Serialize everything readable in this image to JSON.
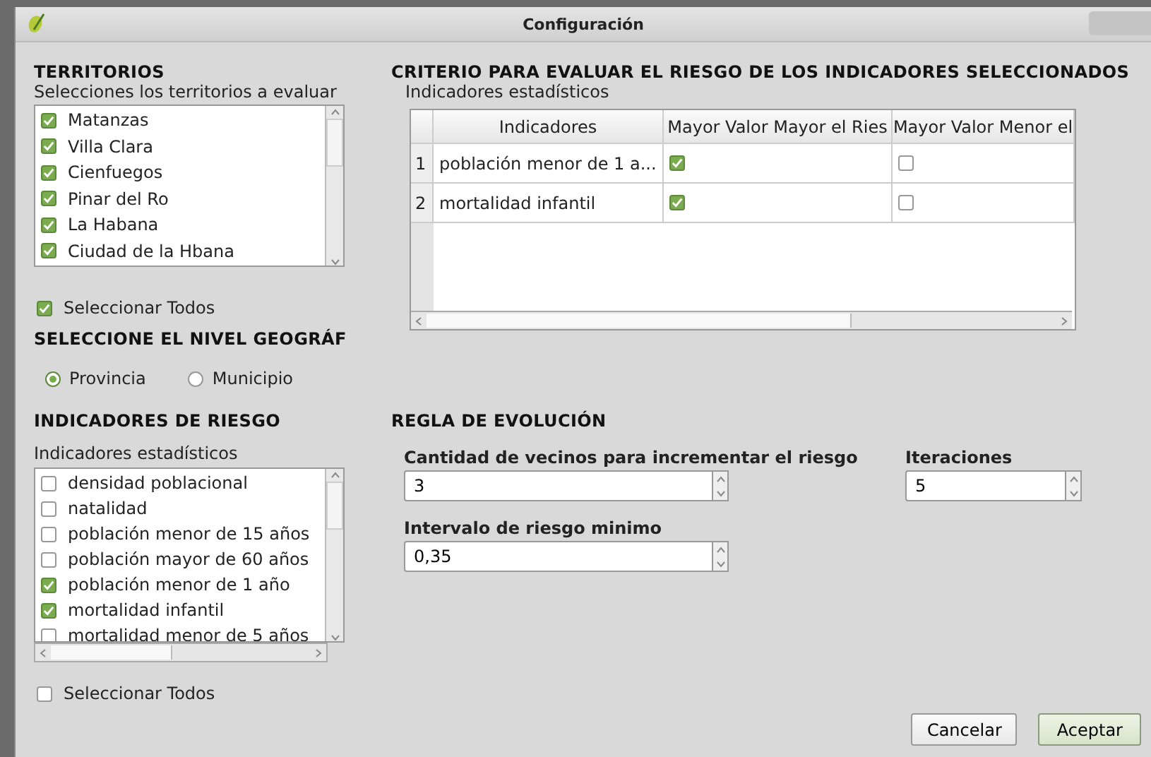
{
  "window": {
    "title": "Configuración"
  },
  "territorios": {
    "heading": "TERRITORIOS",
    "subtitle": "Selecciones los territorios a evaluar",
    "items": [
      {
        "label": "Matanzas",
        "checked": true
      },
      {
        "label": "Villa Clara",
        "checked": true
      },
      {
        "label": "Cienfuegos",
        "checked": true
      },
      {
        "label": "Pinar del Ro",
        "checked": true
      },
      {
        "label": "La Habana",
        "checked": true
      },
      {
        "label": "Ciudad de la Hbana",
        "checked": true
      }
    ],
    "select_all": {
      "label": "Seleccionar Todos",
      "checked": true
    }
  },
  "nivel": {
    "heading": "SELECCIONE EL NIVEL GEOGRÁF",
    "options": [
      {
        "label": "Provincia",
        "selected": true
      },
      {
        "label": "Municipio",
        "selected": false
      }
    ]
  },
  "indicadores": {
    "heading": "INDICADORES DE RIESGO",
    "subtitle": "Indicadores estadísticos",
    "items": [
      {
        "label": "densidad poblacional",
        "checked": false
      },
      {
        "label": "natalidad",
        "checked": false
      },
      {
        "label": "población menor de 15 años",
        "checked": false
      },
      {
        "label": "población mayor de 60 años",
        "checked": false
      },
      {
        "label": "población menor de 1 año",
        "checked": true
      },
      {
        "label": "mortalidad infantil",
        "checked": true
      },
      {
        "label": "mortalidad menor de 5 años",
        "checked": false
      }
    ],
    "select_all": {
      "label": "Seleccionar Todos",
      "checked": false
    }
  },
  "criterio": {
    "heading": "CRITERIO PARA EVALUAR EL RIESGO DE LOS INDICADORES SELECCIONADOS",
    "subtitle": "Indicadores estadísticos",
    "table": {
      "columns": [
        "Indicadores",
        "Mayor Valor Mayor el Ries",
        "Mayor Valor Menor el"
      ],
      "rows": [
        {
          "number": "1",
          "indicator": "población menor de 1 a...",
          "mayor": true,
          "menor": false
        },
        {
          "number": "2",
          "indicator": "mortalidad infantil",
          "mayor": true,
          "menor": false
        }
      ]
    }
  },
  "regla": {
    "heading": "REGLA DE EVOLUCIÓN",
    "fields": [
      {
        "label": "Cantidad de vecinos para incrementar el riesgo",
        "value": "3"
      },
      {
        "label": "Iteraciones",
        "value": "5"
      },
      {
        "label": "Intervalo de riesgo minimo",
        "value": "0,35"
      }
    ]
  },
  "buttons": [
    {
      "label": "Cancelar",
      "default": false
    },
    {
      "label": "Aceptar",
      "default": true
    }
  ]
}
